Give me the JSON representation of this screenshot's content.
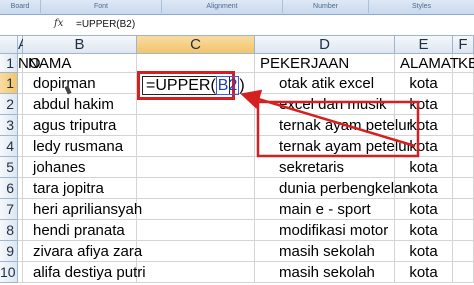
{
  "ribbon": {
    "groups": [
      "Board",
      "Font",
      "Alignment",
      "Number",
      "Styles"
    ]
  },
  "formula_bar": {
    "fx": "fx",
    "content": "=UPPER(B2)"
  },
  "columns": [
    "A",
    "B",
    "C",
    "D",
    "E",
    "F"
  ],
  "header_row": {
    "no": "NO",
    "nama": "NAMA",
    "pekerjaan": "PEKERJAAN",
    "alamat": "ALAMAT",
    "f": "KE"
  },
  "rows": [
    {
      "num": "2",
      "no": "1",
      "nama": "dopirman",
      "pekerjaan": "otak atik excel",
      "alamat": "kota"
    },
    {
      "num": "3",
      "no": "2",
      "nama": "abdul hakim",
      "pekerjaan": "excel dan musik",
      "alamat": "kota"
    },
    {
      "num": "4",
      "no": "3",
      "nama": "agus triputra",
      "pekerjaan": "ternak ayam petelur",
      "alamat": "kota"
    },
    {
      "num": "5",
      "no": "4",
      "nama": "ledy rusmana",
      "pekerjaan": "ternak ayam petelur",
      "alamat": "kota"
    },
    {
      "num": "6",
      "no": "5",
      "nama": "johanes",
      "pekerjaan": "sekretaris",
      "alamat": "kota"
    },
    {
      "num": "7",
      "no": "6",
      "nama": "tara jopitra",
      "pekerjaan": "dunia perbengkelan",
      "alamat": "kota"
    },
    {
      "num": "8",
      "no": "7",
      "nama": "heri apriliansyah",
      "pekerjaan": "main e - sport",
      "alamat": "kota"
    },
    {
      "num": "9",
      "no": "8",
      "nama": "hendi pranata",
      "pekerjaan": "modifikasi motor",
      "alamat": "kota"
    },
    {
      "num": "10",
      "no": "9",
      "nama": "zivara afiya zara",
      "pekerjaan": "masih sekolah",
      "alamat": "kota"
    },
    {
      "num": "11",
      "no": "10",
      "nama": "alifa destiya putri",
      "pekerjaan": "masih sekolah",
      "alamat": "kota"
    }
  ],
  "active_cell": {
    "prefix": "=UPPER(",
    "ref": "B2",
    "suffix": ")"
  },
  "colors": {
    "annotation": "#d42020",
    "selected_header": "#f3c46a"
  }
}
